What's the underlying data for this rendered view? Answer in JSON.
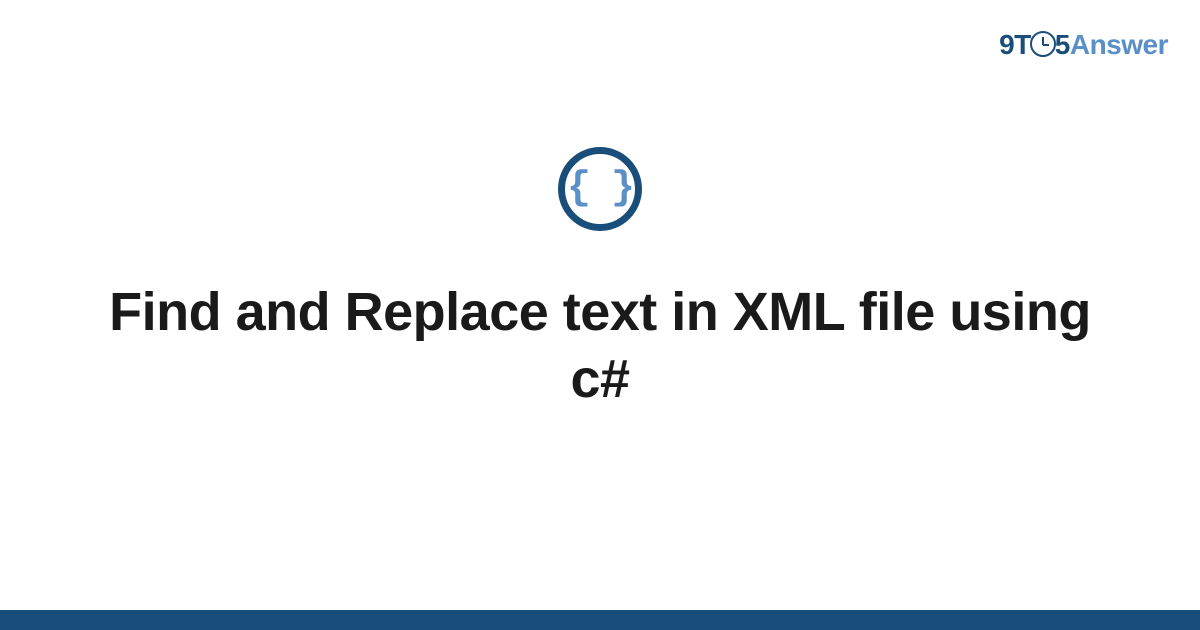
{
  "logo": {
    "part1": "9T",
    "part2": "5",
    "part3": "Answer"
  },
  "icon": {
    "braces": "{ }"
  },
  "title": "Find and Replace text in XML file using c#"
}
